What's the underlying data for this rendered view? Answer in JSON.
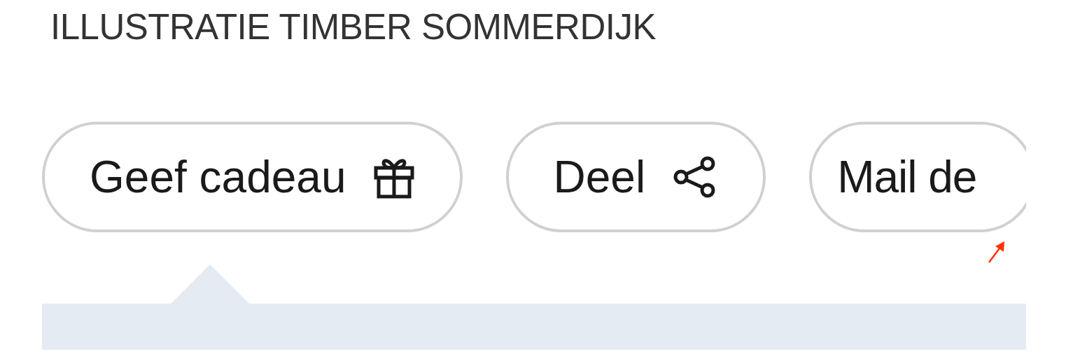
{
  "title": "ILLUSTRATIE TIMBER SOMMERDIJK",
  "buttons": [
    {
      "label": "Geef cadeau",
      "kind": "gift"
    },
    {
      "label": "Deel",
      "kind": "share"
    },
    {
      "label": "Mail de",
      "kind": "plain"
    }
  ]
}
